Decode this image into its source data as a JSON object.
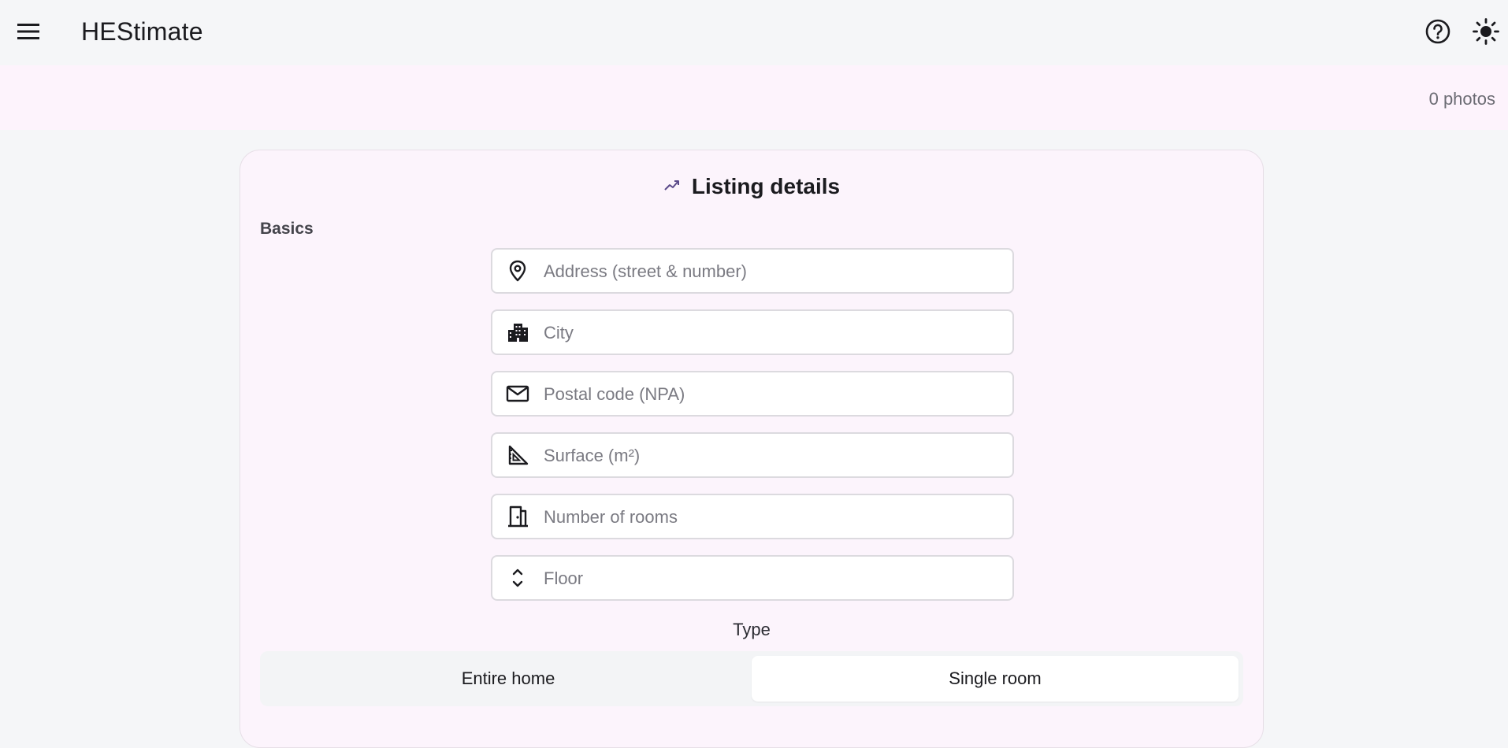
{
  "app": {
    "title": "HEStimate"
  },
  "photos": {
    "count_label": "0 photos"
  },
  "card": {
    "title": "Listing details",
    "section_basics": "Basics",
    "fields": [
      {
        "icon": "location-pin-icon",
        "placeholder": "Address (street & number)",
        "value": ""
      },
      {
        "icon": "city-buildings-icon",
        "placeholder": "City",
        "value": ""
      },
      {
        "icon": "envelope-icon",
        "placeholder": "Postal code (NPA)",
        "value": ""
      },
      {
        "icon": "set-square-ruler-icon",
        "placeholder": "Surface (m²)",
        "value": ""
      },
      {
        "icon": "door-icon",
        "placeholder": "Number of rooms",
        "value": ""
      },
      {
        "icon": "up-down-chevron-icon",
        "placeholder": "Floor",
        "value": ""
      }
    ],
    "type_label": "Type",
    "type_options": [
      "Entire home",
      "Single room"
    ],
    "type_selected": "Single room"
  },
  "colors": {
    "page_bg": "#f5f6f8",
    "strip_bg": "#fdf3fc",
    "card_bg": "#fcf4fc",
    "accent": "#5b4a8a"
  }
}
